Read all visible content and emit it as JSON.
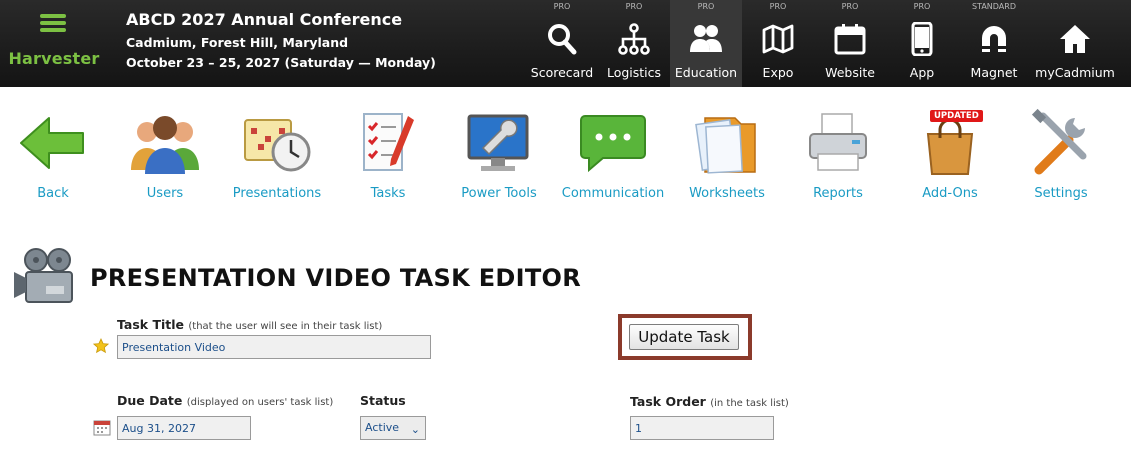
{
  "brand": {
    "name": "Harvester"
  },
  "conference": {
    "title": "ABCD 2027 Annual Conference",
    "location": "Cadmium, Forest Hill, Maryland",
    "dates": "October 23 – 25, 2027 (Saturday — Monday)"
  },
  "modules": [
    {
      "tier": "PRO",
      "label": "Scorecard",
      "icon": "search-icon"
    },
    {
      "tier": "PRO",
      "label": "Logistics",
      "icon": "network-icon"
    },
    {
      "tier": "PRO",
      "label": "Education",
      "icon": "people-icon",
      "active": true
    },
    {
      "tier": "PRO",
      "label": "Expo",
      "icon": "map-icon"
    },
    {
      "tier": "PRO",
      "label": "Website",
      "icon": "calendar-icon"
    },
    {
      "tier": "PRO",
      "label": "App",
      "icon": "phone-icon"
    },
    {
      "tier": "STANDARD",
      "label": "Magnet",
      "icon": "magnet-icon"
    },
    {
      "tier": "",
      "label": "myCadmium",
      "icon": "home-icon"
    }
  ],
  "toolbar": [
    {
      "label": "Back",
      "icon": "back-arrow-icon"
    },
    {
      "label": "Users",
      "icon": "users-icon"
    },
    {
      "label": "Presentations",
      "icon": "calendar-clock-icon"
    },
    {
      "label": "Tasks",
      "icon": "checklist-icon"
    },
    {
      "label": "Power Tools",
      "icon": "monitor-wrench-icon"
    },
    {
      "label": "Communication",
      "icon": "chat-bubble-icon"
    },
    {
      "label": "Worksheets",
      "icon": "folder-icon"
    },
    {
      "label": "Reports",
      "icon": "printer-icon"
    },
    {
      "label": "Add-Ons",
      "icon": "shopping-bag-icon",
      "badge": "UPDATED"
    },
    {
      "label": "Settings",
      "icon": "tools-icon"
    }
  ],
  "editor": {
    "title": "PRESENTATION VIDEO TASK EDITOR",
    "task_title": {
      "label": "Task Title",
      "hint": "(that the user will see in their task list)",
      "value": "Presentation Video"
    },
    "due_date": {
      "label": "Due Date",
      "hint": "(displayed on users' task list)",
      "value": "Aug 31, 2027"
    },
    "status": {
      "label": "Status",
      "value": "Active"
    },
    "task_order": {
      "label": "Task Order",
      "hint": "(in the task list)",
      "value": "1"
    },
    "update_button": "Update Task"
  },
  "colors": {
    "brand_green": "#7cc043",
    "link_blue": "#1a9bc4",
    "highlight_frame": "#8b3a2b",
    "badge_red": "#e01818"
  }
}
